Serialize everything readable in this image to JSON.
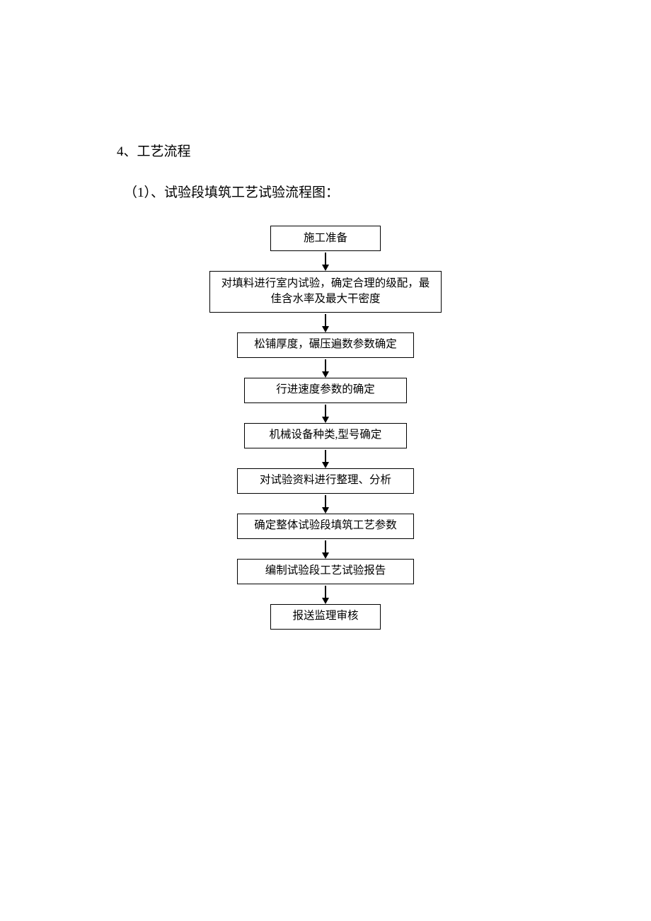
{
  "heading": "4、工艺流程",
  "subheading": "（1）、试验段填筑工艺试验流程图：",
  "chart_data": {
    "type": "flowchart",
    "direction": "top-to-bottom",
    "nodes": [
      {
        "id": "n1",
        "label": "施工准备"
      },
      {
        "id": "n2",
        "label": "对填料进行室内试验，确定合理的级配，最佳含水率及最大干密度"
      },
      {
        "id": "n3",
        "label": "松铺厚度，碾压遍数参数确定"
      },
      {
        "id": "n4",
        "label": "行进速度参数的确定"
      },
      {
        "id": "n5",
        "label": "机械设备种类,型号确定"
      },
      {
        "id": "n6",
        "label": "对试验资料进行整理、分析"
      },
      {
        "id": "n7",
        "label": "确定整体试验段填筑工艺参数"
      },
      {
        "id": "n8",
        "label": "编制试验段工艺试验报告"
      },
      {
        "id": "n9",
        "label": "报送监理审核"
      }
    ],
    "edges": [
      [
        "n1",
        "n2"
      ],
      [
        "n2",
        "n3"
      ],
      [
        "n3",
        "n4"
      ],
      [
        "n4",
        "n5"
      ],
      [
        "n5",
        "n6"
      ],
      [
        "n6",
        "n7"
      ],
      [
        "n7",
        "n8"
      ],
      [
        "n8",
        "n9"
      ]
    ]
  }
}
